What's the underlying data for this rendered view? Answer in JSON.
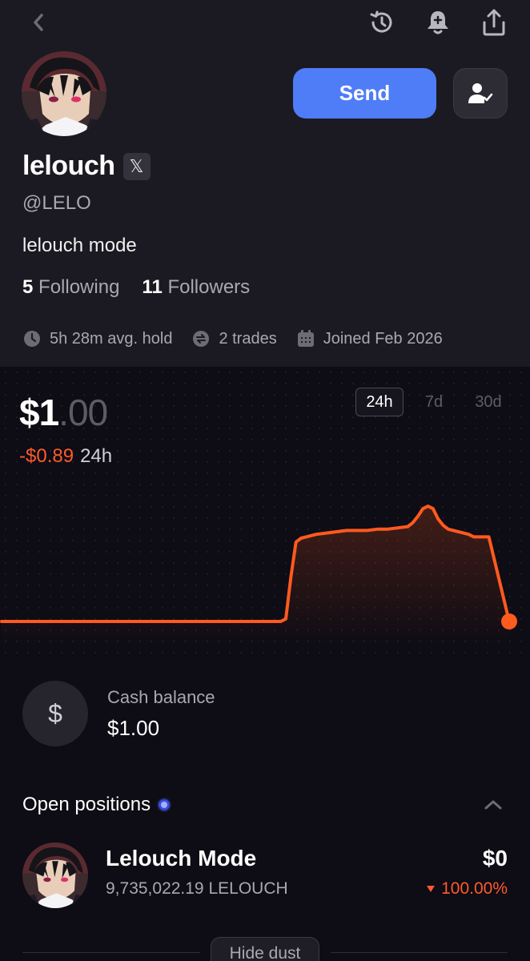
{
  "header": {
    "back_icon": "chevron-left-icon",
    "icons": [
      "history-icon",
      "bell-plus-icon",
      "share-icon"
    ]
  },
  "profile": {
    "name": "lelouch",
    "x_badge": "𝕏",
    "handle": "@LELO",
    "bio": "lelouch mode",
    "following_count": "5",
    "following_label": "Following",
    "followers_count": "11",
    "followers_label": "Followers",
    "send_label": "Send",
    "stats": {
      "avg_hold": "5h 28m avg. hold",
      "trades": "2 trades",
      "joined": "Joined Feb 2026"
    }
  },
  "portfolio": {
    "price_main": "$1",
    "price_cents": ".00",
    "change_value": "-$0.89",
    "change_period": "24h",
    "ranges": [
      "24h",
      "7d",
      "30d"
    ],
    "active_range": "24h"
  },
  "chart_data": {
    "type": "line",
    "x": [
      0,
      5,
      10,
      15,
      20,
      25,
      30,
      35,
      40,
      45,
      50,
      55,
      56,
      57,
      58,
      59,
      60,
      62,
      64,
      66,
      68,
      70,
      72,
      74,
      76,
      78,
      80,
      81,
      82,
      83,
      84,
      85,
      86,
      87,
      88,
      90,
      91,
      92,
      93,
      94,
      95,
      96,
      100
    ],
    "series": [
      {
        "values": [
          1.0,
          1.0,
          1.0,
          1.0,
          1.0,
          1.0,
          1.0,
          1.0,
          1.0,
          1.0,
          1.0,
          1.0,
          1.02,
          1.35,
          1.62,
          1.65,
          1.66,
          1.68,
          1.69,
          1.7,
          1.71,
          1.71,
          1.71,
          1.72,
          1.72,
          1.73,
          1.74,
          1.77,
          1.82,
          1.88,
          1.9,
          1.88,
          1.8,
          1.75,
          1.72,
          1.7,
          1.69,
          1.68,
          1.66,
          1.66,
          1.66,
          1.66,
          1.0
        ]
      }
    ],
    "xlabel": "",
    "ylabel": "",
    "grid": false,
    "color": "#ff5a1f"
  },
  "cash": {
    "icon": "dollar-icon",
    "label": "Cash balance",
    "value": "$1.00"
  },
  "positions": {
    "title": "Open positions",
    "items": [
      {
        "name": "Lelouch Mode",
        "amount": "9,735,022.19 LELOUCH",
        "value": "$0",
        "change": "100.00%",
        "change_direction": "down"
      }
    ],
    "hide_dust_label": "Hide dust"
  },
  "colors": {
    "accent_blue": "#4f7cf7",
    "negative": "#ff5a2c",
    "background": "#1b1a22",
    "chart_background": "#0e0c14"
  }
}
